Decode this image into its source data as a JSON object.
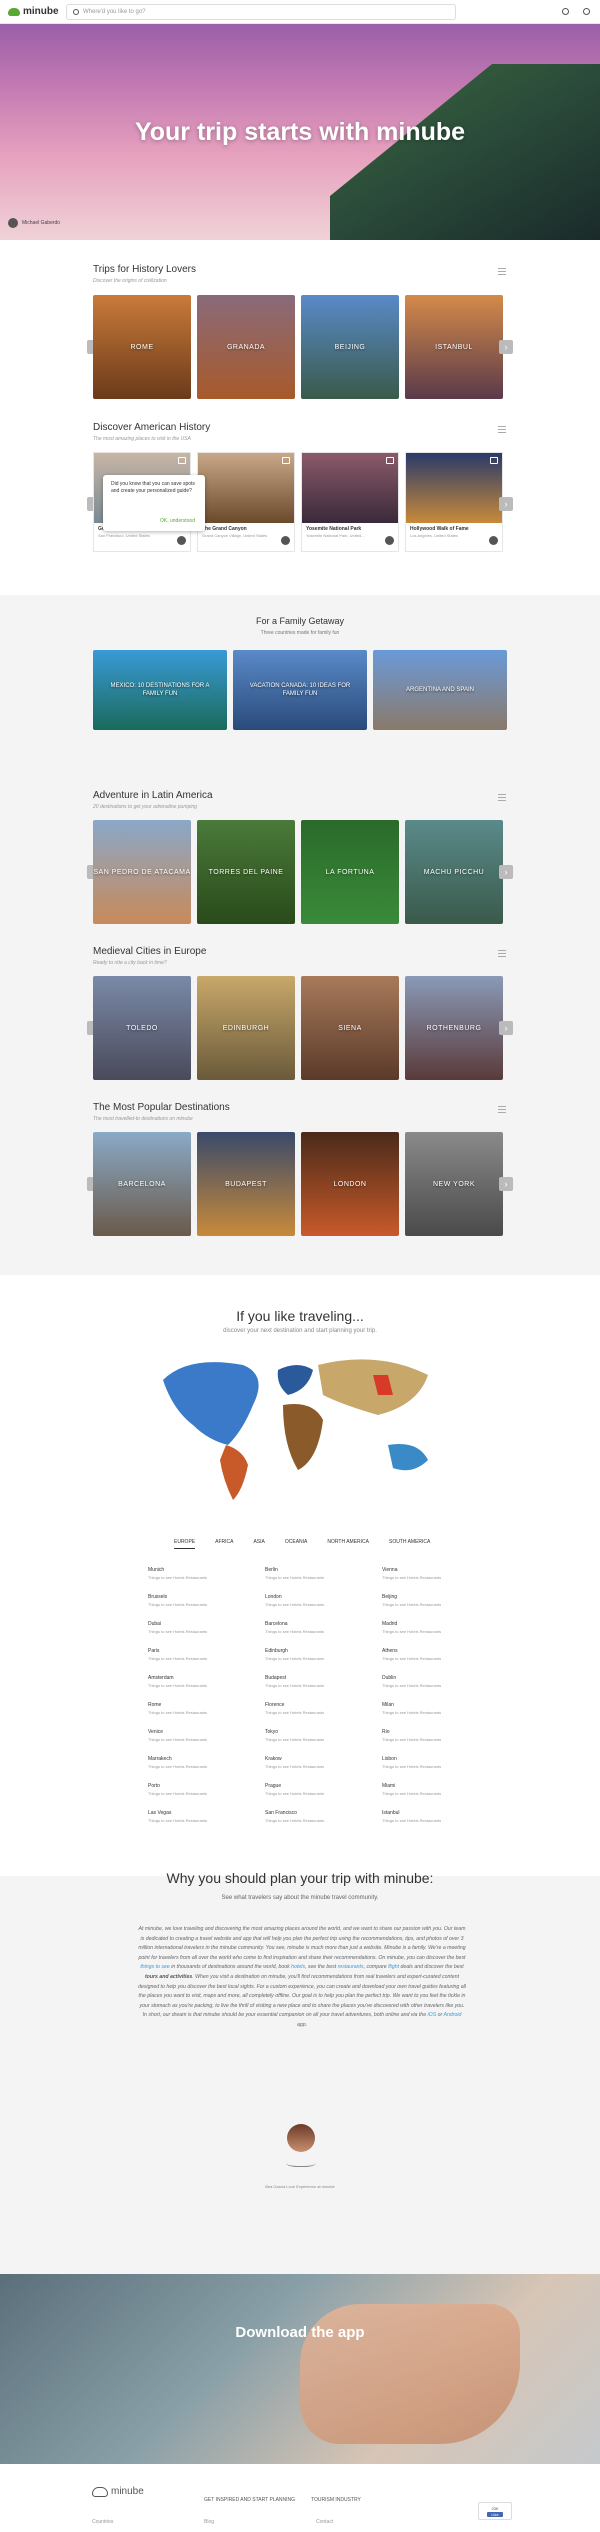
{
  "header": {
    "logo": "minube",
    "search_placeholder": "Where'd you like to go?"
  },
  "hero": {
    "title": "Your trip starts with minube",
    "author": "Michael Gaberdo"
  },
  "history": {
    "title": "Trips for History Lovers",
    "subtitle": "Discover the origins of civilization",
    "cards": [
      "ROME",
      "GRANADA",
      "BEIJING",
      "ISTANBUL"
    ]
  },
  "american": {
    "title": "Discover American History",
    "subtitle": "The most amazing places to visit in the USA",
    "cards": [
      {
        "title": "Golden Gate Bridge",
        "loc": "San Francisco, United States"
      },
      {
        "title": "The Grand Canyon",
        "loc": "Grand Canyon Village, United States"
      },
      {
        "title": "Yosemite National Park",
        "loc": "Yosemite National Park, United..."
      },
      {
        "title": "Hollywood Walk of Fame",
        "loc": "Los Angeles, United States"
      }
    ],
    "tooltip": "Did you know that you can save spots and create your personalized guide?",
    "tooltip_ok": "OK, understood"
  },
  "family": {
    "title": "For a Family Getaway",
    "subtitle": "Three countries made for family fun",
    "cards": [
      "MEXICO: 10 DESTINATIONS FOR A FAMILY FUN",
      "VACATION CANADA: 10 IDEAS FOR FAMILY FUN",
      "ARGENTINA AND SPAIN"
    ]
  },
  "latin": {
    "title": "Adventure in Latin America",
    "subtitle": "20 destinations to get your adrenaline pumping",
    "cards": [
      "SAN PEDRO DE ATACAMA",
      "TORRES DEL PAINE",
      "LA FORTUNA",
      "MACHU PICCHU"
    ]
  },
  "medieval": {
    "title": "Medieval Cities in Europe",
    "subtitle": "Ready to ride a city back in time?",
    "cards": [
      "TOLEDO",
      "EDINBURGH",
      "SIENA",
      "ROTHENBURG"
    ]
  },
  "popular": {
    "title": "The Most Popular Destinations",
    "subtitle": "The most travelled-to destinations on minube",
    "cards": [
      "BARCELONA",
      "BUDAPEST",
      "LONDON",
      "NEW YORK"
    ]
  },
  "map": {
    "title": "If you like traveling...",
    "subtitle": "discover your next destination and start planning your trip.",
    "tabs": [
      "EUROPE",
      "AFRICA",
      "ASIA",
      "OCEANIA",
      "NORTH AMERICA",
      "SOUTH AMERICA"
    ],
    "link": "Things to see  Hotels  Restaurants",
    "cities": [
      "Munich",
      "Berlin",
      "Vienna",
      "Brussels",
      "London",
      "Beijing",
      "Dubai",
      "Barcelona",
      "Madrid",
      "Paris",
      "Edinburgh",
      "Athens",
      "Amsterdam",
      "Budapest",
      "Dublin",
      "Rome",
      "Florence",
      "Milan",
      "Venice",
      "Tokyo",
      "Rio",
      "Marrakech",
      "Krakow",
      "Lisbon",
      "Porto",
      "Prague",
      "Miami",
      "Las Vegas",
      "San Francisco",
      "Istanbul"
    ]
  },
  "why": {
    "title": "Why you should plan your trip with minube:",
    "subtitle": "See what travelers say about the minube travel community.",
    "signature_name": "Bea Garcia Love Experience at minube"
  },
  "app": {
    "title": "Download the app"
  },
  "footer": {
    "logo": "minube",
    "links": [
      "GET INSPIRED AND START PLANNING",
      "TOURISM INDUSTRY"
    ],
    "cols": [
      "Countries",
      "Blog",
      "Contact"
    ],
    "fb_count": "23K",
    "fb_btn": "Like"
  },
  "colors": {
    "brand": "#5aa832",
    "link": "#3c9bd6"
  }
}
